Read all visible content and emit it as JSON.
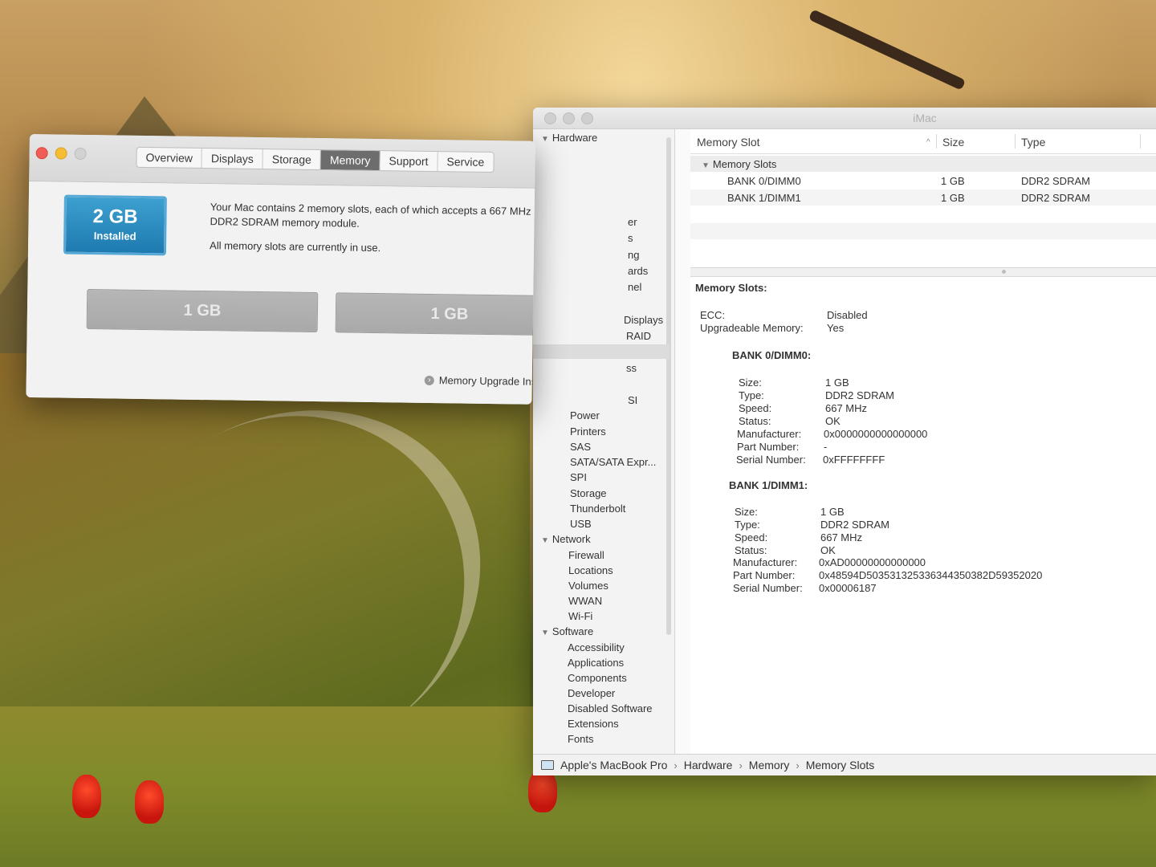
{
  "about": {
    "tabs": [
      "Overview",
      "Displays",
      "Storage",
      "Memory",
      "Support",
      "Service"
    ],
    "active_tab": "Memory",
    "badge_amount": "2 GB",
    "badge_label": "Installed",
    "description_1": "Your Mac contains 2 memory slots, each of which accepts a 667 MHz DDR2 SDRAM memory module.",
    "description_2": "All memory slots are currently in use.",
    "slots": [
      "1 GB",
      "1 GB"
    ],
    "upgrade_link": "Memory Upgrade Instructions"
  },
  "sysinfo": {
    "title": "iMac",
    "sidebar": {
      "hardware": "Hardware",
      "partial_items": [
        "er",
        "s",
        "ng",
        "ards",
        "nel",
        "Displays",
        "RAID",
        "ss",
        "SI"
      ],
      "hardware_items": [
        "Power",
        "Printers",
        "SAS",
        "SATA/SATA Expr...",
        "SPI",
        "Storage",
        "Thunderbolt",
        "USB"
      ],
      "network": "Network",
      "network_items": [
        "Firewall",
        "Locations",
        "Volumes",
        "WWAN",
        "Wi-Fi"
      ],
      "software": "Software",
      "software_items": [
        "Accessibility",
        "Applications",
        "Components",
        "Developer",
        "Disabled Software",
        "Extensions",
        "Fonts"
      ]
    },
    "table": {
      "headers": [
        "Memory Slot",
        "Size",
        "Type"
      ],
      "group": "Memory Slots",
      "rows": [
        {
          "slot": "BANK 0/DIMM0",
          "size": "1 GB",
          "type": "DDR2 SDRAM"
        },
        {
          "slot": "BANK 1/DIMM1",
          "size": "1 GB",
          "type": "DDR2 SDRAM"
        }
      ]
    },
    "detail": {
      "heading": "Memory Slots:",
      "ecc_label": "ECC:",
      "ecc_value": "Disabled",
      "upgradeable_label": "Upgradeable Memory:",
      "upgradeable_value": "Yes",
      "banks": [
        {
          "title": "BANK 0/DIMM0:",
          "size": "1 GB",
          "type": "DDR2 SDRAM",
          "speed": "667 MHz",
          "status": "OK",
          "manufacturer": "0x0000000000000000",
          "part_number": "-",
          "serial_number": "0xFFFFFFFF"
        },
        {
          "title": "BANK 1/DIMM1:",
          "size": "1 GB",
          "type": "DDR2 SDRAM",
          "speed": "667 MHz",
          "status": "OK",
          "manufacturer": "0xAD00000000000000",
          "part_number": "0x48594D503531325336344350382D59352020",
          "serial_number": "0x00006187"
        }
      ],
      "field_labels": [
        "Size:",
        "Type:",
        "Speed:",
        "Status:",
        "Manufacturer:",
        "Part Number:",
        "Serial Number:"
      ]
    },
    "path": [
      "Apple's MacBook Pro",
      "Hardware",
      "Memory",
      "Memory Slots"
    ]
  },
  "colors": {
    "badge": "#1e7ab0",
    "active_tab": "#6d6d6d",
    "close_light": "#f05d56",
    "minimize_light": "#f5bd33"
  }
}
